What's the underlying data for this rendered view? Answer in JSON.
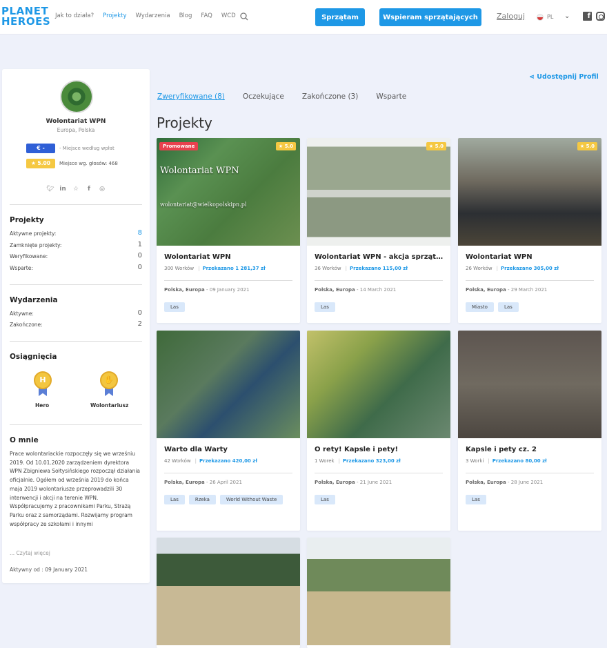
{
  "header": {
    "logo_line1": "PLANET",
    "logo_line2": "HEROES",
    "nav": [
      "Jak to działa?",
      "Projekty",
      "Wydarzenia",
      "Blog",
      "FAQ",
      "WCD"
    ],
    "btn_clean": "Sprzątam",
    "btn_support": "Wspieram sprzątających",
    "login": "Zaloguj",
    "lang": "PL"
  },
  "profile": {
    "name": "Wolontariat WPN",
    "location": "Europa, Polska",
    "euro_badge": "€ -",
    "euro_text": "- Miejsce według wpłat",
    "rating_badge": "★ 5.00",
    "rating_text": "Miejsce wg. głosów: 468",
    "projects_title": "Projekty",
    "projects": [
      {
        "label": "Aktywne projekty:",
        "value": "8"
      },
      {
        "label": "Zamknięte projekty:",
        "value": "1"
      },
      {
        "label": "Weryfikowane:",
        "value": "0"
      },
      {
        "label": "Wsparte:",
        "value": "0"
      }
    ],
    "events_title": "Wydarzenia",
    "events": [
      {
        "label": "Aktywne:",
        "value": "0"
      },
      {
        "label": "Zakończone:",
        "value": "2"
      }
    ],
    "achievements_title": "Osiągnięcia",
    "achievements": [
      "Hero",
      "Wolontariusz"
    ],
    "about_title": "O mnie",
    "about_text": "Prace wolontariackie rozpoczęły się we wrześniu 2019. Od 10.01.2020 zarządzeniem dyrektora WPN Zbigniewa Sołtysińskiego rozpoczął działania oficjalnie. Ogółem od września 2019 do końca maja 2019 wolontariusze przeprowadzili 30 interwencji i akcji na terenie WPN. Współpracujemy z pracownikami Parku, Strażą Parku oraz z samorządami. Rozwijamy program współpracy ze szkołami i innymi",
    "read_more": "... Czytaj więcej",
    "active_since": "Aktywny od : 09 January 2021"
  },
  "main": {
    "share": "Udostępnij Profil",
    "tabs": [
      "Zweryfikowane (8)",
      "Oczekujące",
      "Zakończone (3)",
      "Wsparte"
    ],
    "title": "Projekty"
  },
  "cards": [
    {
      "title": "Wolontariat WPN",
      "bags": "300 Worków",
      "funded": "Przekazano 1 281,37 zł",
      "loc": "Polska, Europa",
      "date": "09 January 2021",
      "tags": [
        "Las"
      ],
      "rating": "5.0",
      "promo": "Promowane"
    },
    {
      "title": "Wolontariat WPN - akcja sprzątania",
      "bags": "36 Worków",
      "funded": "Przekazano 115,00 zł",
      "loc": "Polska, Europa",
      "date": "14 March 2021",
      "tags": [
        "Las"
      ],
      "rating": "5.0"
    },
    {
      "title": "Wolontariat WPN",
      "bags": "26 Worków",
      "funded": "Przekazano 305,00 zł",
      "loc": "Polska, Europa",
      "date": "29 March 2021",
      "tags": [
        "Miasto",
        "Las"
      ],
      "rating": "5.0"
    },
    {
      "title": "Warto dla Warty",
      "bags": "42 Worków",
      "funded": "Przekazano 420,00 zł",
      "loc": "Polska, Europa",
      "date": "26 April 2021",
      "tags": [
        "Las",
        "Rzeka",
        "World Without Waste"
      ]
    },
    {
      "title": "O rety! Kapsle i pety!",
      "bags": "1 Worek",
      "funded": "Przekazano 323,00 zł",
      "loc": "Polska, Europa",
      "date": "21 June 2021",
      "tags": [
        "Las"
      ]
    },
    {
      "title": "Kapsle i pety cz. 2",
      "bags": "3 Worki",
      "funded": "Przekazano 80,00 zł",
      "loc": "Polska, Europa",
      "date": "28 June 2021",
      "tags": [
        "Las"
      ]
    }
  ],
  "card1_overlay": {
    "title": "Wolontariat WPN",
    "email": "wolontariat@wielkopolskipn.pl"
  }
}
